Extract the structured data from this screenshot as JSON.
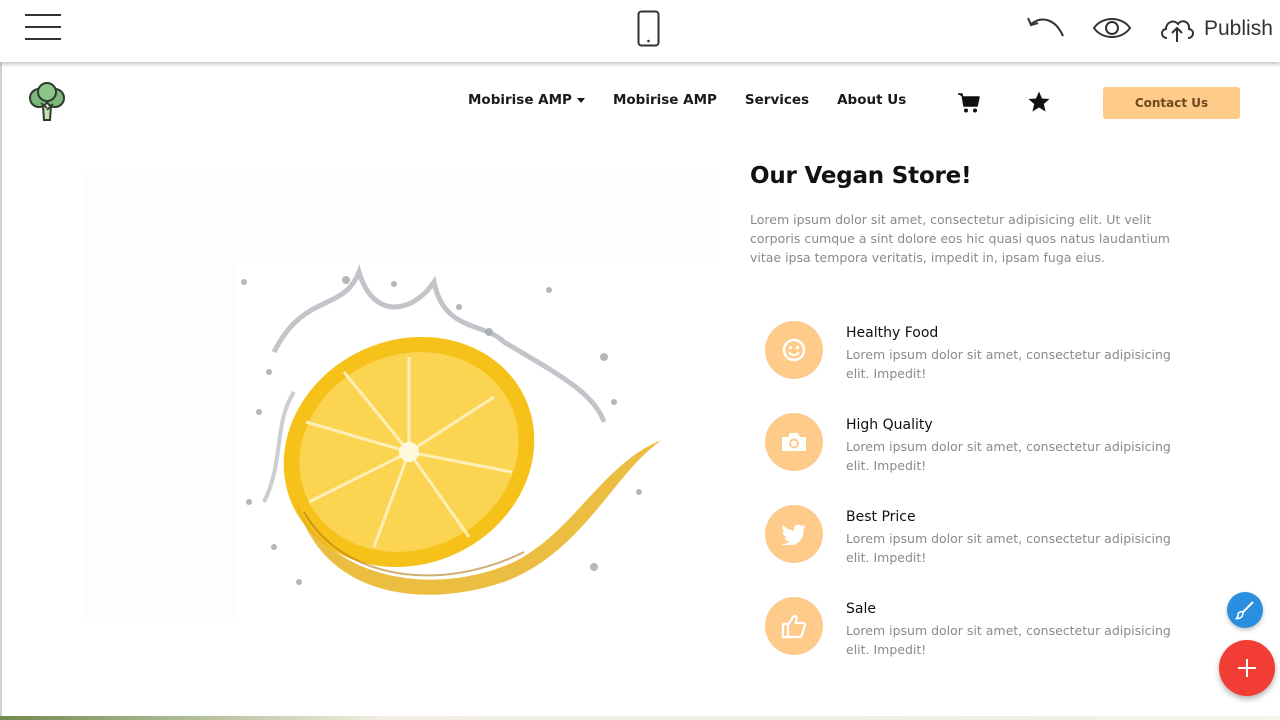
{
  "toolbar": {
    "menu_icon": "hamburger-menu-icon",
    "device_icon": "mobile-phone-icon",
    "undo_icon": "undo-icon",
    "preview_icon": "eye-icon",
    "publish_icon": "cloud-upload-icon",
    "publish_label": "Publish"
  },
  "nav": {
    "logo_icon": "broccoli-logo-icon",
    "links": [
      {
        "label": "Mobirise AMP",
        "has_dropdown": true
      },
      {
        "label": "Mobirise AMP",
        "has_dropdown": false
      },
      {
        "label": "Services",
        "has_dropdown": false
      },
      {
        "label": "About Us",
        "has_dropdown": false
      }
    ],
    "cart_icon": "shopping-cart-icon",
    "star_icon": "star-icon",
    "contact_label": "Contact Us"
  },
  "hero": {
    "image_description_icon": "lemon-splash-image"
  },
  "content": {
    "title": "Our Vegan Store!",
    "description": "Lorem ipsum dolor sit amet, consectetur adipisicing elit. Ut velit corporis cumque a sint dolore eos hic quasi quos natus laudantium vitae ipsa tempora veritatis, impedit in, ipsam fuga eius.",
    "features": [
      {
        "icon": "smile-icon",
        "title": "Healthy Food",
        "text": "Lorem ipsum dolor sit amet, consectetur adipisicing elit. Impedit!"
      },
      {
        "icon": "camera-icon",
        "title": "High Quality",
        "text": "Lorem ipsum dolor sit amet, consectetur adipisicing elit. Impedit!"
      },
      {
        "icon": "twitter-icon",
        "title": "Best Price",
        "text": "Lorem ipsum dolor sit amet, consectetur adipisicing elit. Impedit!"
      },
      {
        "icon": "thumbs-up-icon",
        "title": "Sale",
        "text": "Lorem ipsum dolor sit amet, consectetur adipisicing elit. Impedit!"
      }
    ]
  },
  "editor": {
    "brush_icon": "brush-icon",
    "add_icon": "plus-icon"
  },
  "colors": {
    "accent": "#fecb8a",
    "fab_blue": "#2a8fe0",
    "fab_red": "#f23d35"
  }
}
